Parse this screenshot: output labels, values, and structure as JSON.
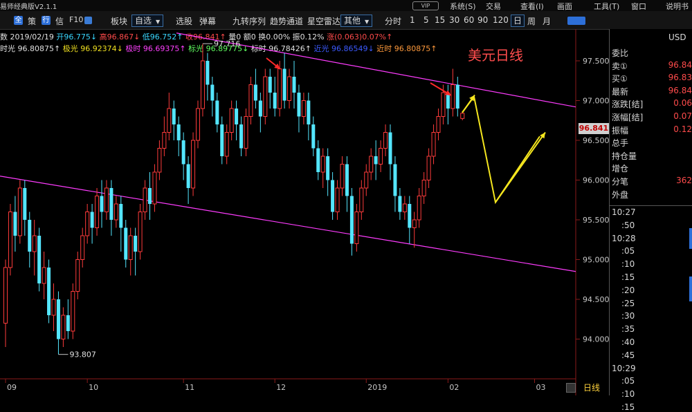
{
  "app": {
    "title": "易师经典版V2.1.1",
    "vip": "VIP",
    "menu": [
      "系统(S)",
      "交易",
      "查看(I)",
      "画面",
      "工具(T)",
      "窗口",
      "说明书"
    ]
  },
  "toolbar": {
    "items": [
      "全",
      "策",
      "行",
      "信",
      "F10",
      "板块",
      "自选",
      "选股",
      "弹幕",
      "九转序列",
      "趋势通道",
      "星空雷达",
      "其他"
    ],
    "periods": [
      "分时",
      "1",
      "5",
      "15",
      "30",
      "60",
      "90",
      "120",
      "日",
      "周",
      "月"
    ],
    "active_period": "日"
  },
  "info": {
    "line1": [
      {
        "t": "数 2019/02/19",
        "c": "w"
      },
      {
        "t": " 开96.775↓",
        "c": "c"
      },
      {
        "t": " 高96.867↓",
        "c": "r"
      },
      {
        "t": " 低96.752↑",
        "c": "c"
      },
      {
        "t": " 收96.841↑",
        "c": "r"
      },
      {
        "t": " 量0",
        "c": "w"
      },
      {
        "t": " 额0",
        "c": "w"
      },
      {
        "t": " 换0.00%",
        "c": "w"
      },
      {
        "t": " 振0.12%",
        "c": "w"
      },
      {
        "t": " 涨(0.063)0.07%↑",
        "c": "r"
      }
    ],
    "line2": [
      {
        "t": " 时光 96.80875↑",
        "c": "w"
      },
      {
        "t": " 极光 96.92374↓",
        "c": "y"
      },
      {
        "t": " 极时 96.69375↑",
        "c": "m"
      },
      {
        "t": " 标光 96.89775↓",
        "c": "lime"
      },
      {
        "t": " 标时 96.78426↑",
        "c": "w"
      },
      {
        "t": " 近光 96.86549↓",
        "c": "b"
      },
      {
        "t": " 近时 96.80875↑",
        "c": "o"
      }
    ]
  },
  "chart_label": "美元日线",
  "chart_data": {
    "type": "candlestick",
    "title": "美元日线",
    "ylim": [
      93.5,
      97.9
    ],
    "y_ticks": [
      "97.500",
      "97.000",
      "96.500",
      "96.000",
      "95.500",
      "95.000",
      "94.500",
      "94.000"
    ],
    "x_ticks": [
      "09",
      "10",
      "11",
      "12",
      "2019",
      "02",
      "03"
    ],
    "annotations": {
      "high": "97.716",
      "low": "93.807"
    },
    "last_price": "96.841",
    "candles": [
      [
        94.2,
        94.9,
        93.9,
        95.0
      ],
      [
        94.9,
        95.6,
        94.8,
        95.7
      ],
      [
        95.6,
        95.3,
        95.1,
        95.8
      ],
      [
        95.3,
        95.9,
        95.2,
        96.0
      ],
      [
        95.9,
        95.5,
        95.3,
        96.0
      ],
      [
        95.5,
        95.1,
        94.9,
        95.6
      ],
      [
        95.1,
        95.3,
        94.8,
        95.5
      ],
      [
        95.3,
        94.7,
        94.6,
        95.4
      ],
      [
        94.7,
        94.9,
        94.5,
        95.1
      ],
      [
        94.9,
        94.3,
        94.2,
        95.0
      ],
      [
        94.3,
        94.5,
        94.1,
        94.7
      ],
      [
        94.5,
        94.0,
        93.807,
        94.6
      ],
      [
        94.0,
        94.3,
        93.9,
        94.4
      ],
      [
        94.3,
        94.1,
        94.0,
        94.5
      ],
      [
        94.1,
        94.6,
        94.0,
        94.7
      ],
      [
        94.6,
        95.0,
        94.5,
        95.1
      ],
      [
        95.0,
        95.3,
        94.9,
        95.4
      ],
      [
        95.3,
        95.6,
        95.2,
        95.7
      ],
      [
        95.6,
        95.4,
        95.2,
        95.7
      ],
      [
        95.4,
        95.8,
        95.3,
        95.9
      ],
      [
        95.8,
        95.6,
        95.4,
        96.0
      ],
      [
        95.6,
        95.9,
        95.5,
        96.0
      ],
      [
        95.9,
        95.5,
        95.3,
        96.0
      ],
      [
        95.5,
        95.7,
        95.4,
        95.8
      ],
      [
        95.7,
        95.4,
        95.1,
        95.8
      ],
      [
        95.4,
        95.0,
        94.9,
        95.5
      ],
      [
        95.0,
        95.3,
        94.8,
        95.4
      ],
      [
        95.3,
        95.1,
        94.8,
        95.4
      ],
      [
        95.1,
        95.6,
        95.0,
        95.7
      ],
      [
        95.6,
        95.9,
        95.5,
        96.0
      ],
      [
        95.9,
        95.7,
        95.5,
        96.1
      ],
      [
        95.7,
        96.1,
        95.6,
        96.2
      ],
      [
        96.1,
        96.4,
        96.0,
        96.5
      ],
      [
        96.4,
        96.6,
        96.3,
        96.8
      ],
      [
        96.6,
        96.9,
        96.5,
        97.1
      ],
      [
        96.9,
        96.7,
        96.5,
        97.0
      ],
      [
        96.7,
        96.5,
        96.3,
        96.8
      ],
      [
        96.5,
        96.2,
        96.0,
        96.6
      ],
      [
        96.2,
        95.9,
        95.7,
        96.3
      ],
      [
        95.9,
        96.5,
        95.8,
        96.6
      ],
      [
        96.5,
        96.9,
        96.4,
        97.0
      ],
      [
        96.9,
        97.5,
        96.8,
        97.716
      ],
      [
        97.5,
        97.2,
        97.0,
        97.6
      ],
      [
        97.2,
        97.0,
        96.8,
        97.3
      ],
      [
        97.0,
        96.7,
        96.6,
        97.1
      ],
      [
        96.7,
        96.3,
        96.2,
        96.8
      ],
      [
        96.3,
        96.6,
        96.2,
        96.7
      ],
      [
        96.6,
        96.9,
        96.5,
        97.0
      ],
      [
        96.9,
        96.7,
        96.5,
        97.0
      ],
      [
        96.7,
        96.4,
        96.3,
        96.8
      ],
      [
        96.4,
        96.8,
        96.3,
        96.9
      ],
      [
        96.8,
        97.2,
        96.7,
        97.3
      ],
      [
        97.2,
        97.0,
        96.9,
        97.4
      ],
      [
        97.0,
        96.8,
        96.6,
        97.1
      ],
      [
        96.8,
        97.3,
        96.7,
        97.4
      ],
      [
        97.3,
        97.1,
        96.9,
        97.4
      ],
      [
        97.1,
        96.9,
        96.8,
        97.3
      ],
      [
        96.9,
        97.4,
        96.8,
        97.5
      ],
      [
        97.4,
        97.0,
        96.9,
        97.6
      ],
      [
        97.0,
        97.3,
        96.9,
        97.4
      ],
      [
        97.3,
        97.1,
        96.9,
        97.5
      ],
      [
        97.1,
        96.8,
        96.6,
        97.2
      ],
      [
        96.8,
        97.0,
        96.7,
        97.1
      ],
      [
        97.0,
        96.7,
        96.5,
        97.1
      ],
      [
        96.7,
        96.4,
        96.3,
        96.8
      ],
      [
        96.4,
        96.1,
        96.0,
        96.5
      ],
      [
        96.1,
        96.3,
        95.9,
        96.4
      ],
      [
        96.3,
        96.0,
        95.8,
        96.4
      ],
      [
        96.0,
        95.6,
        95.5,
        96.1
      ],
      [
        95.6,
        95.9,
        95.5,
        96.0
      ],
      [
        95.9,
        96.2,
        95.8,
        96.3
      ],
      [
        96.2,
        95.8,
        95.6,
        96.3
      ],
      [
        95.8,
        95.2,
        95.05,
        95.9
      ],
      [
        95.2,
        95.6,
        95.1,
        95.7
      ],
      [
        95.6,
        95.9,
        95.5,
        96.0
      ],
      [
        95.9,
        96.1,
        95.8,
        96.2
      ],
      [
        96.1,
        96.3,
        96.0,
        96.4
      ],
      [
        96.3,
        96.2,
        96.0,
        96.5
      ],
      [
        96.2,
        96.4,
        96.1,
        96.5
      ],
      [
        96.4,
        96.6,
        96.3,
        96.7
      ],
      [
        96.6,
        96.2,
        96.0,
        96.7
      ],
      [
        96.2,
        95.8,
        95.6,
        96.3
      ],
      [
        95.8,
        95.6,
        95.5,
        95.9
      ],
      [
        95.6,
        95.7,
        95.5,
        95.8
      ],
      [
        95.7,
        95.4,
        95.2,
        95.8
      ],
      [
        95.4,
        95.5,
        95.15,
        95.6
      ],
      [
        95.5,
        95.8,
        95.4,
        95.9
      ],
      [
        95.8,
        96.0,
        95.7,
        96.1
      ],
      [
        96.0,
        96.3,
        95.9,
        96.4
      ],
      [
        96.3,
        96.6,
        96.2,
        96.7
      ],
      [
        96.6,
        96.8,
        96.5,
        96.9
      ],
      [
        96.8,
        97.1,
        96.7,
        97.2
      ],
      [
        97.1,
        96.9,
        96.7,
        97.2
      ],
      [
        96.9,
        97.2,
        96.8,
        97.4
      ],
      [
        97.2,
        96.9,
        96.8,
        97.3
      ],
      [
        96.775,
        96.841,
        96.752,
        96.867
      ]
    ]
  },
  "right_panel": {
    "currency": "USD",
    "rows": [
      {
        "label": "委比",
        "value": ""
      },
      {
        "label": "卖①",
        "value": "96.84"
      },
      {
        "label": "买①",
        "value": "96.83"
      },
      {
        "label": "最新",
        "value": "96.84"
      },
      {
        "label": "涨跌[结]",
        "value": "0.06"
      },
      {
        "label": "涨幅[结]",
        "value": "0.07"
      },
      {
        "label": "振幅",
        "value": "0.12"
      },
      {
        "label": "总手",
        "value": ""
      },
      {
        "label": "持仓量",
        "value": ""
      },
      {
        "label": "增仓",
        "value": ""
      },
      {
        "label": "分笔",
        "value": "362"
      },
      {
        "label": "外盘",
        "value": ""
      }
    ],
    "times": [
      {
        "main": "10:27",
        "subs": [
          ":50"
        ]
      },
      {
        "main": "10:28",
        "subs": [
          ":05",
          ":10",
          ":15",
          ":20",
          ":25",
          ":30",
          ":35",
          ":40",
          ":45"
        ]
      },
      {
        "main": "10:29",
        "subs": [
          ":05",
          ":10",
          ":15"
        ]
      }
    ]
  },
  "footer": {
    "period_label": "日线"
  }
}
